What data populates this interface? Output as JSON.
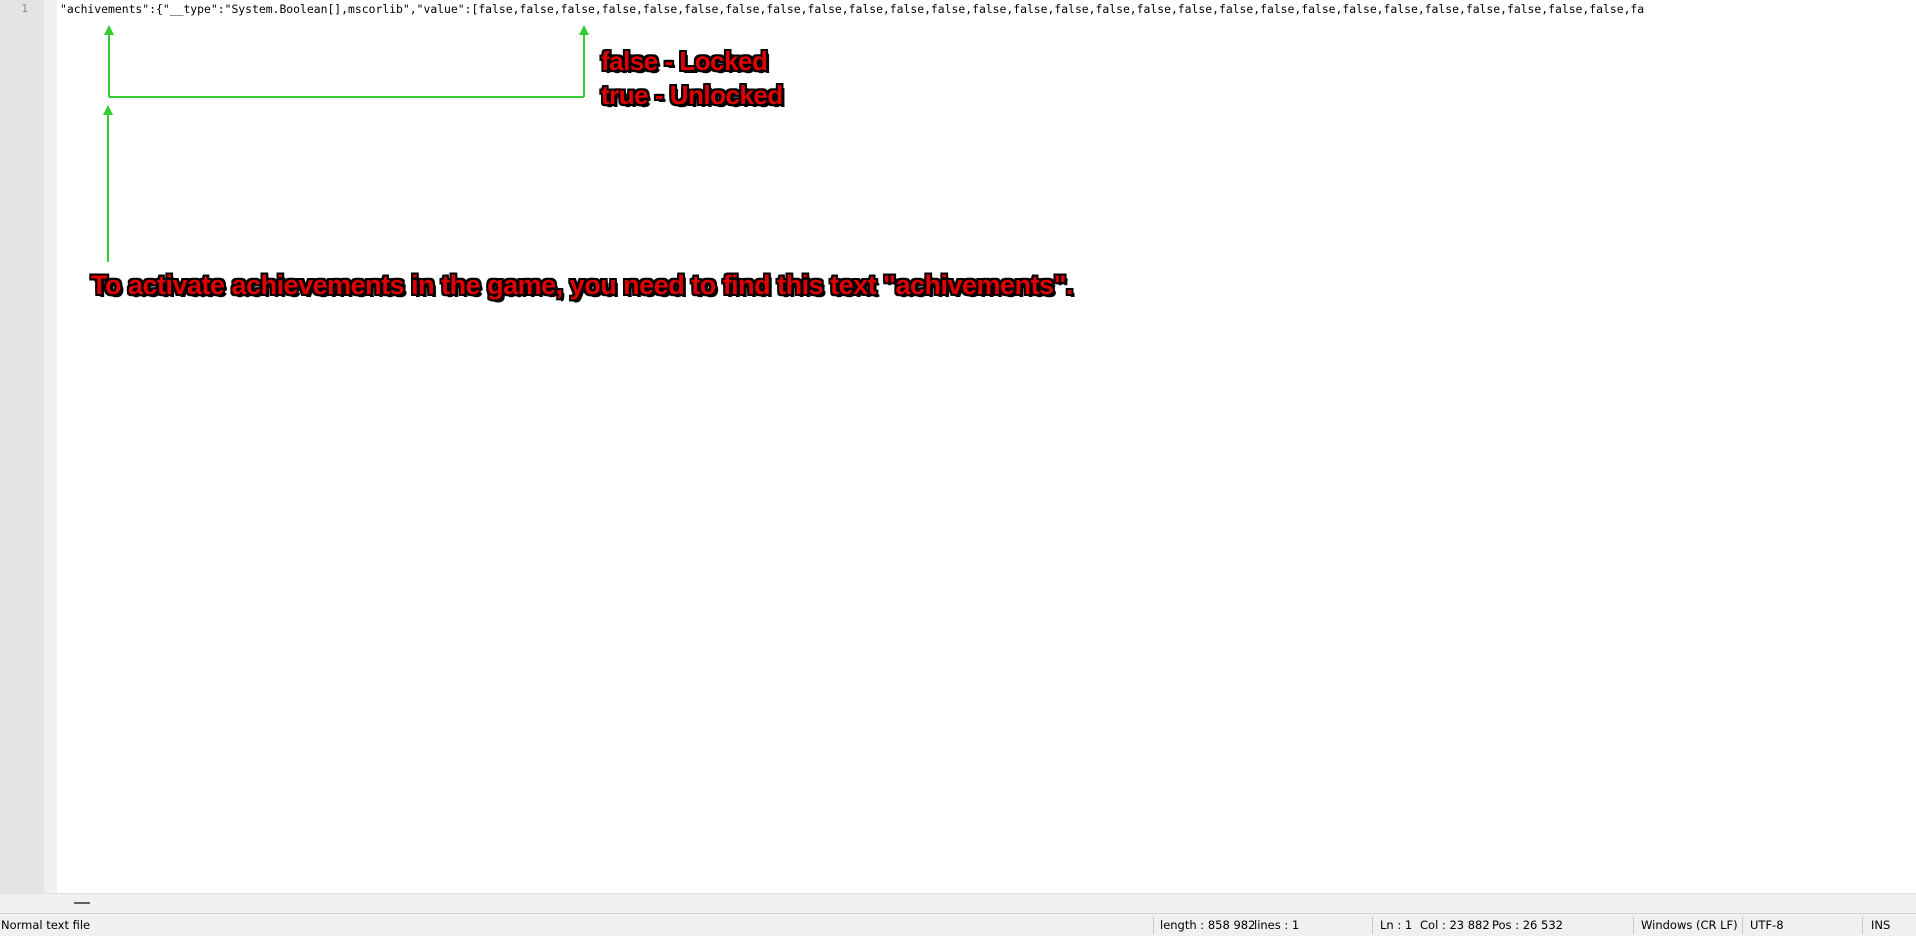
{
  "gutter": {
    "line_number": "1"
  },
  "editor": {
    "line_text": "\"achivements\":{\"__type\":\"System.Boolean[],mscorlib\",\"value\":[false,false,false,false,false,false,false,false,false,false,false,false,false,false,false,false,false,false,false,false,false,false,false,false,false,false,false,false,fa"
  },
  "annotations": {
    "false_label": "false - Locked",
    "true_label": "true - Unlocked",
    "instruction": "To activate achievements in the game, you need to find this text \"achivements\"."
  },
  "statusbar": {
    "file_type": "Normal text file",
    "length": "length : 858 982",
    "lines": "lines : 1",
    "ln": "Ln : 1",
    "col": "Col : 23 882",
    "pos": "Pos : 26 532",
    "eol": "Windows (CR LF)",
    "encoding": "UTF-8",
    "mode": "INS"
  },
  "colors": {
    "annotation_text": "#e00000",
    "arrow": "#33cc33"
  }
}
